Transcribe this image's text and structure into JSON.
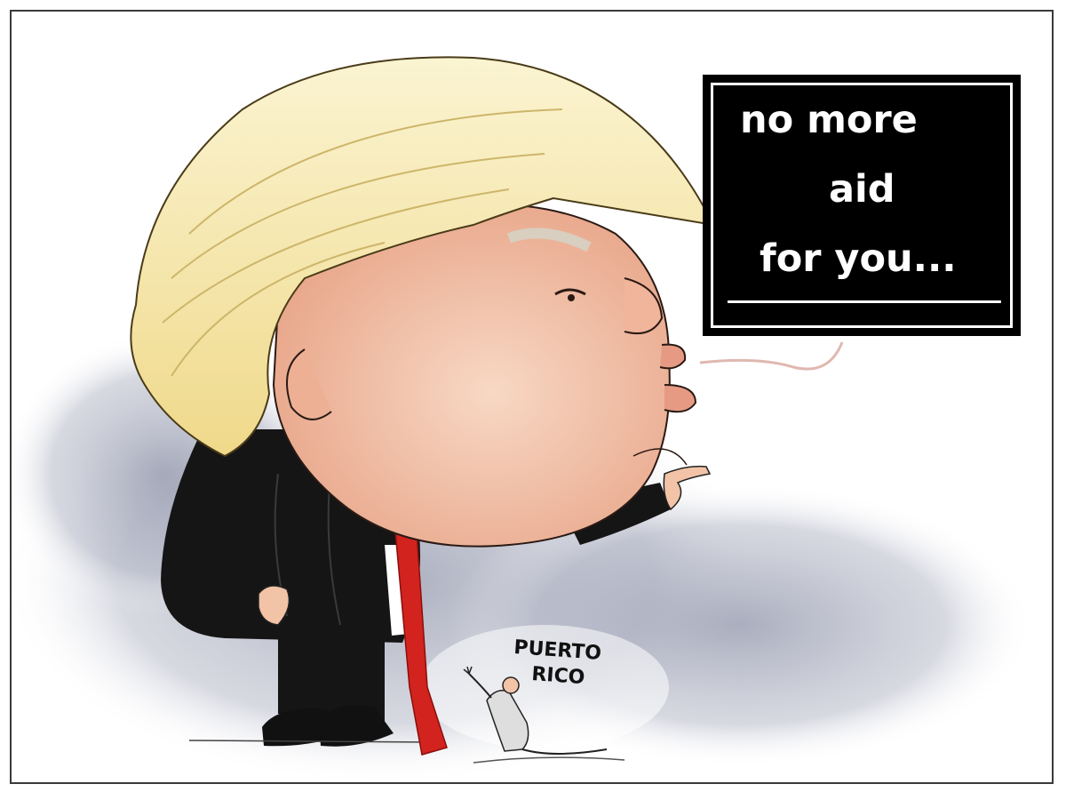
{
  "caption": {
    "line1": "no more",
    "line2": "aid",
    "line3": "for you..."
  },
  "figure_label": {
    "line1": "PUERTO",
    "line2": "RICO"
  },
  "colors": {
    "frame": "#3a3a3a",
    "caption_bg": "#000000",
    "caption_text": "#ffffff",
    "hair": "#f4e7a8",
    "skin": "#f2c3a6",
    "suit": "#151515",
    "tie": "#d2231e",
    "shadow": "#8e93a8"
  },
  "icons": {
    "main_figure": "caricature-figure",
    "small_figure": "pleading-person-icon"
  }
}
